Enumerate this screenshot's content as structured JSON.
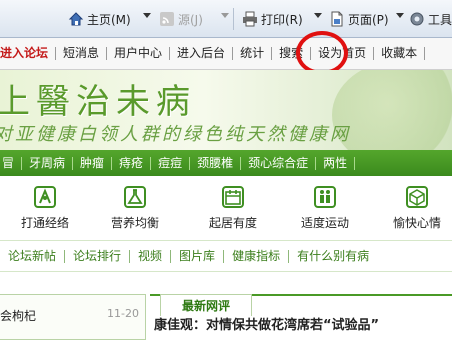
{
  "browser_toolbar": {
    "home": "主页(M)",
    "feeds": "源(J)",
    "print": "打印(R)",
    "page": "页面(P)",
    "tools": "工具"
  },
  "site_nav": {
    "items": [
      "进入论坛",
      "短消息",
      "用户中心",
      "进入后台",
      "统计",
      "搜索",
      "设为首页",
      "收藏本"
    ]
  },
  "banner": {
    "title": "上醫治未病",
    "slogan": "对亚健康白领人群的绿色纯天然健康网"
  },
  "categories": [
    "冒",
    "牙周病",
    "肿瘤",
    "痔疮",
    "痘痘",
    "颈腰椎",
    "颈心综合症",
    "两性"
  ],
  "icon_tiles": [
    {
      "label": "打通经络",
      "icon": "meridian-icon"
    },
    {
      "label": "营养均衡",
      "icon": "flask-icon"
    },
    {
      "label": "起居有度",
      "icon": "calendar-icon"
    },
    {
      "label": "适度运动",
      "icon": "exercise-icon"
    },
    {
      "label": "愉快心情",
      "icon": "cube-icon"
    }
  ],
  "links": [
    "论坛新帖",
    "论坛排行",
    "视频",
    "图片库",
    "健康指标",
    "有什么别有病"
  ],
  "lower": {
    "left_news": "会枸杞",
    "left_time": "11-20",
    "tab_label": "最新网评",
    "headline": "康佳观：对情保共做花湾席若“试验品”"
  },
  "colors": {
    "accent_green": "#3b8a1d",
    "nav_red": "#c41a1a",
    "highlight_circle": "#e01010"
  }
}
